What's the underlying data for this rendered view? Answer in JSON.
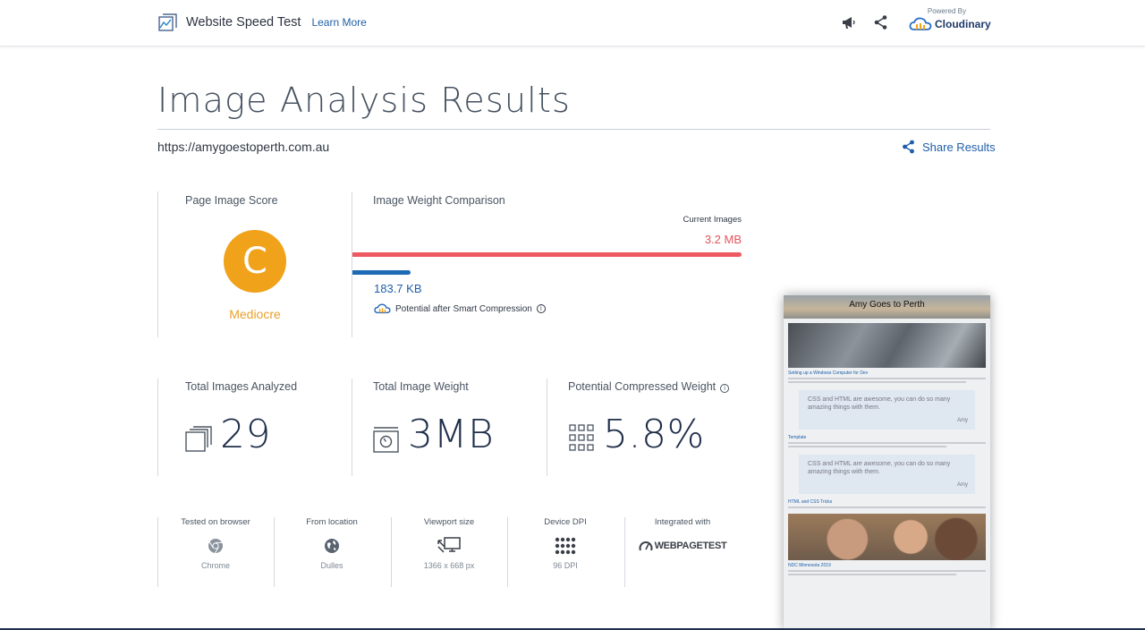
{
  "header": {
    "app_title": "Website Speed Test",
    "learn_more": "Learn More",
    "powered_by": "Powered By",
    "brand": "Cloudinary",
    "icons": [
      "megaphone-icon",
      "share-icon"
    ]
  },
  "page": {
    "title": "Image Analysis Results",
    "url": "https://amygoestoperth.com.au",
    "share_label": "Share Results"
  },
  "score": {
    "label": "Page Image Score",
    "grade": "C",
    "grade_word": "Mediocre",
    "grade_color": "#f0a21a"
  },
  "comparison": {
    "label": "Image Weight Comparison",
    "current_label": "Current Images",
    "current_value": "3.2 MB",
    "potential_value": "183.7 KB",
    "potential_note": "Potential after Smart Compression",
    "potential_fraction": 0.15,
    "current_color": "#ee5a61",
    "potential_color": "#1e6bb5"
  },
  "stats": {
    "total_images_label": "Total Images Analyzed",
    "total_images_value": "29",
    "total_weight_label": "Total Image Weight",
    "total_weight_value": "3MB",
    "compressed_label": "Potential Compressed Weight",
    "compressed_value": "5.8%"
  },
  "test_info": [
    {
      "label": "Tested on browser",
      "value": "Chrome",
      "icon": "chrome-icon"
    },
    {
      "label": "From location",
      "value": "Dulles",
      "icon": "location-icon"
    },
    {
      "label": "Viewport size",
      "value": "1366 x 668 px",
      "icon": "viewport-icon"
    },
    {
      "label": "Device DPI",
      "value": "96 DPI",
      "icon": "dpi-grid-icon"
    },
    {
      "label": "Integrated with",
      "value": "WEBPAGETEST",
      "icon": "webpagetest-logo"
    }
  ],
  "preview": {
    "site_title": "Amy Goes to Perth",
    "post1_title": "Setting up a Windows Computer for Dev",
    "quote_text": "CSS and HTML are awesome, you can do so many amazing things with them.",
    "quote_author": "Amy",
    "post2_title": "Template",
    "post3_title": "HTML and CSS Tricks",
    "post4_title": "NDC Minnesota 2019"
  }
}
